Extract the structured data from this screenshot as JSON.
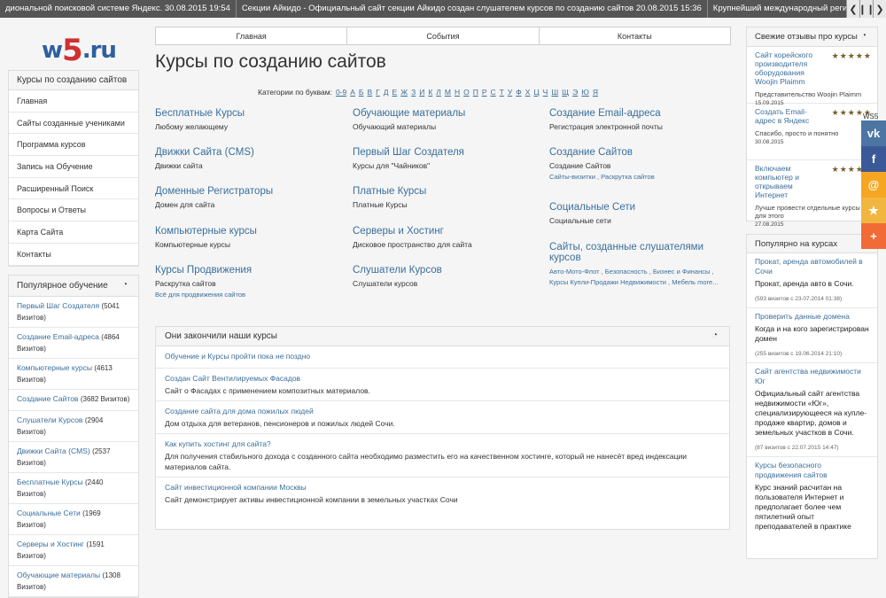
{
  "ticker": {
    "items": [
      "диональной поисковой системе Яндекс. 30.08.2015 19:54",
      "Секции Айкидо - Официальный сайт секции Айкидо создан слушателем курсов по созданию сайтов 20.08.2015 15:36",
      "Крупнейший международный регистрато"
    ],
    "controls": [
      "❮",
      "❙❙",
      "❯"
    ]
  },
  "logo": {
    "a": "w",
    "b": "5",
    "c": ".ru"
  },
  "left_nav": {
    "title": "Курсы по созданию сайтов",
    "items": [
      "Главная",
      "Сайты созданные учениками",
      "Программа курсов",
      "Запись на Обучение",
      "Расширенный Поиск",
      "Вопросы и Ответы",
      "Карта Сайта",
      "Контакты"
    ]
  },
  "popular": {
    "title": "Популярное обучение",
    "items": [
      {
        "name": "Первый Шаг Создателя",
        "count": "(5041 Визитов)"
      },
      {
        "name": "Создание Email-адреса",
        "count": "(4864 Визитов)"
      },
      {
        "name": "Компьютерные курсы",
        "count": "(4613 Визитов)"
      },
      {
        "name": "Создание Сайтов",
        "count": "(3682 Визитов)"
      },
      {
        "name": "Слушатели Курсов",
        "count": "(2904 Визитов)"
      },
      {
        "name": "Движки Сайта (CMS)",
        "count": "(2537 Визитов)"
      },
      {
        "name": "Бесплатные Курсы",
        "count": "(2440 Визитов)"
      },
      {
        "name": "Социальные Сети",
        "count": "(1969 Визитов)"
      },
      {
        "name": "Серверы и Хостинг",
        "count": "(1591 Визитов)"
      },
      {
        "name": "Обучающие материалы",
        "count": "(1308 Визитов)"
      }
    ]
  },
  "topnav": [
    "Главная",
    "События",
    "Контакты"
  ],
  "page_title": "Курсы по созданию сайтов",
  "alphabet": {
    "label": "Категории по буквам:",
    "letters": [
      "0-9",
      "А",
      "Б",
      "В",
      "Г",
      "Д",
      "Е",
      "Ж",
      "З",
      "И",
      "К",
      "Л",
      "М",
      "Н",
      "О",
      "П",
      "Р",
      "С",
      "Т",
      "У",
      "Ф",
      "Х",
      "Ц",
      "Ч",
      "Ш",
      "Щ",
      "Э",
      "Ю",
      "Я"
    ]
  },
  "categories": {
    "c1": {
      "title": "Бесплатные Курсы",
      "desc": "Любому желающему"
    },
    "c2": {
      "title": "Движки Сайта (CMS)",
      "desc": "Движки сайта"
    },
    "c3": {
      "title": "Доменные Регистраторы",
      "desc": "Домен для сайта"
    },
    "c4": {
      "title": "Компьютерные курсы",
      "desc": "Компьютерные курсы"
    },
    "c5": {
      "title": "Курсы Продвижения",
      "desc": "Раскрутка сайтов",
      "sub": "Всё для продвижения сайтов"
    },
    "c6": {
      "title": "Обучающие материалы",
      "desc": "Обучающий материалы"
    },
    "c7": {
      "title": "Первый Шаг Создателя",
      "desc": "Курсы для \"Чайников\""
    },
    "c8": {
      "title": "Платные Курсы",
      "desc": "Платные Курсы"
    },
    "c9": {
      "title": "Серверы и Хостинг",
      "desc": "Дисковое пространство для сайта"
    },
    "c10": {
      "title": "Слушатели Курсов",
      "desc": "Слушатели курсов"
    },
    "c11": {
      "title": "Создание Email-адреса",
      "desc": "Регистрация электронной почты"
    },
    "c12": {
      "title": "Создание Сайтов",
      "desc": "Создание Сайтов",
      "sub": "Сайты-визитки , Раскрутка сайтов"
    },
    "c13": {
      "title": "Социальные Сети",
      "desc": "Социальные сети"
    },
    "c14": {
      "title": "Сайты, созданные слушателями курсов",
      "sub": "Авто-Мото-Флот , Безопасность , Бизнес и Финансы , Курсы Купли-Продажи Недвижимости , Мебель more..."
    }
  },
  "graduates": {
    "title": "Они закончили наши курсы",
    "rows": [
      {
        "title": "Обучение и Курсы пройти пока не поздно",
        "desc": ""
      },
      {
        "title": "Создан Сайт Вентилируемых Фасадов",
        "desc": "Сайт о Фасадах с применением композитных материалов."
      },
      {
        "title": "Создание сайта для дома пожилых людей",
        "desc": "Дом отдыха для ветеранов, пенсионеров и пожилых людей Сочи."
      },
      {
        "title": "Как купить хостинг для сайта?",
        "desc": "Для получения стабильного дохода с созданного сайта необходимо разместить его на качественном хостинге, который не нанесёт вред индексации материалов сайта."
      },
      {
        "title": "Сайт инвестиционной компании Москвы",
        "desc": "Сайт демонстрирует активы инвестиционной компании в земельных участках Сочи"
      }
    ]
  },
  "reviews": {
    "title": "Свежие отзывы про курсы",
    "items": [
      {
        "title": "Сайт корейского производителя оборудования Woojin Plaimm",
        "stars": "★★★★★",
        "desc": "Представительство Woojin Plaimm",
        "date": "15.09.2015"
      },
      {
        "title": "Создать Email-адрес в Яндекс",
        "stars": "★★★★★",
        "desc": "Спасибо, просто и понятно",
        "date": "30.08.2015"
      },
      {
        "title": "Включаем компьютер и открываем Интернет",
        "stars": "★★★★★",
        "desc": "Лучше провести отдельные курсы для этого",
        "date": "27.08.2015"
      }
    ]
  },
  "popular_courses": {
    "title": "Популярно на курсах",
    "items": [
      {
        "title": "Прокат, аренда автомобилей в Сочи",
        "desc": "Прокат, аренда авто в Сочи.",
        "visits": "(593 визитов с 23.07.2014 01:38)"
      },
      {
        "title": "Проверить данные домена",
        "desc": "Когда и на кого зарегистрирован домен",
        "visits": "(255 визитов с 19.06.2014 21:10)"
      },
      {
        "title": "Сайт агентства недвижимости Юг",
        "desc": "Официальный сайт агентства недвижимости «Юг», специализирующееся на купле-продаже квартир, домов и земельных участков в Сочи.",
        "visits": "(87 визитов с 22.07.2015 14:47)"
      },
      {
        "title": "Курсы безопасного продвижения сайтов",
        "desc": "Курс знаний расчитан на пользователя Интернет и предполагает более чем пятилетний опыт преподавателей в практике",
        "visits": ""
      }
    ]
  },
  "share": {
    "label": "WS5",
    "buttons": [
      {
        "icon": "vk-icon",
        "glyph": "vk",
        "color": "#4c75a3"
      },
      {
        "icon": "facebook-icon",
        "glyph": "f",
        "color": "#3b5998"
      },
      {
        "icon": "mail-icon",
        "glyph": "@",
        "color": "#f5a623"
      },
      {
        "icon": "favorite-icon",
        "glyph": "★",
        "color": "#f0b640"
      },
      {
        "icon": "more-icon",
        "glyph": "+",
        "color": "#f26a36"
      }
    ]
  }
}
